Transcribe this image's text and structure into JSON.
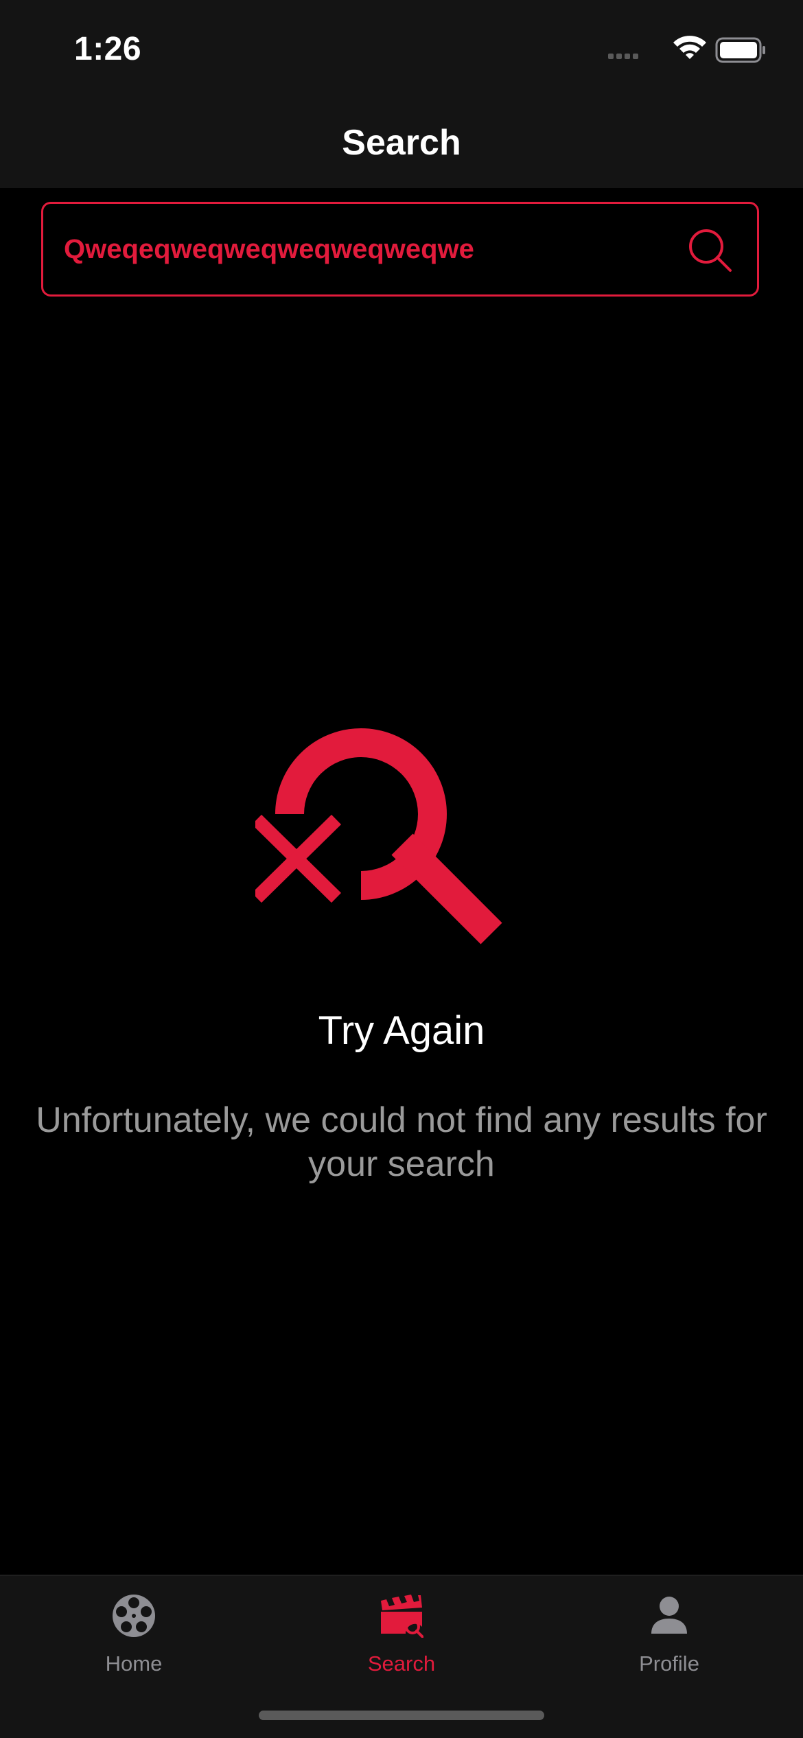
{
  "status_bar": {
    "time": "1:26"
  },
  "nav": {
    "title": "Search"
  },
  "search": {
    "value": "Qweqeqweqweqweqweqweqwe",
    "icon": "search-icon"
  },
  "empty_state": {
    "icon": "search-no-results-icon",
    "title": "Try Again",
    "message": "Unfortunately, we could not find any results for your search"
  },
  "tab_bar": {
    "tabs": [
      {
        "label": "Home",
        "icon": "film-reel-icon",
        "active": false
      },
      {
        "label": "Search",
        "icon": "clapperboard-search-icon",
        "active": true
      },
      {
        "label": "Profile",
        "icon": "person-icon",
        "active": false
      }
    ]
  },
  "colors": {
    "accent": "#e21b3c",
    "background": "#000000",
    "bar_background": "#141414",
    "inactive": "#8e8e93",
    "secondary_text": "#9a9a9a"
  }
}
